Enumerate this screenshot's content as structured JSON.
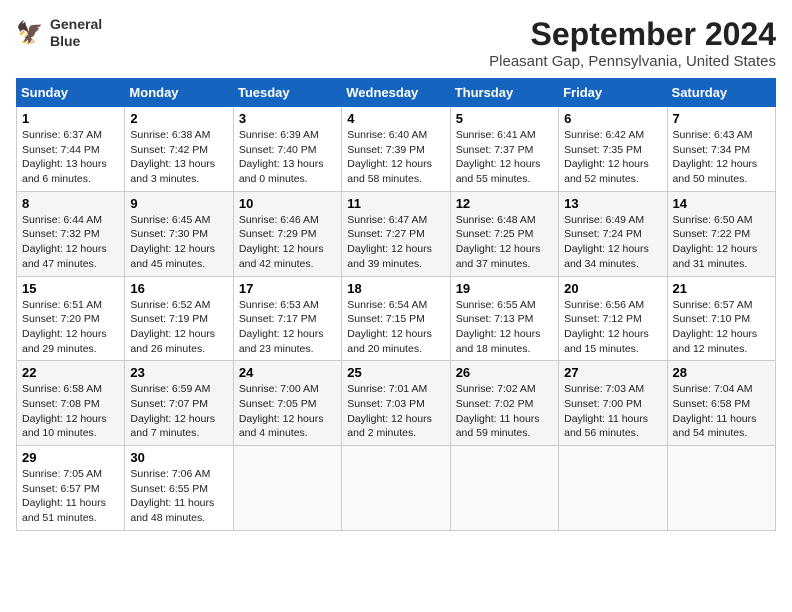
{
  "header": {
    "logo_line1": "General",
    "logo_line2": "Blue",
    "month": "September 2024",
    "location": "Pleasant Gap, Pennsylvania, United States"
  },
  "days_of_week": [
    "Sunday",
    "Monday",
    "Tuesday",
    "Wednesday",
    "Thursday",
    "Friday",
    "Saturday"
  ],
  "weeks": [
    [
      {
        "day": "1",
        "sunrise": "6:37 AM",
        "sunset": "7:44 PM",
        "daylight": "13 hours and 6 minutes."
      },
      {
        "day": "2",
        "sunrise": "6:38 AM",
        "sunset": "7:42 PM",
        "daylight": "13 hours and 3 minutes."
      },
      {
        "day": "3",
        "sunrise": "6:39 AM",
        "sunset": "7:40 PM",
        "daylight": "13 hours and 0 minutes."
      },
      {
        "day": "4",
        "sunrise": "6:40 AM",
        "sunset": "7:39 PM",
        "daylight": "12 hours and 58 minutes."
      },
      {
        "day": "5",
        "sunrise": "6:41 AM",
        "sunset": "7:37 PM",
        "daylight": "12 hours and 55 minutes."
      },
      {
        "day": "6",
        "sunrise": "6:42 AM",
        "sunset": "7:35 PM",
        "daylight": "12 hours and 52 minutes."
      },
      {
        "day": "7",
        "sunrise": "6:43 AM",
        "sunset": "7:34 PM",
        "daylight": "12 hours and 50 minutes."
      }
    ],
    [
      {
        "day": "8",
        "sunrise": "6:44 AM",
        "sunset": "7:32 PM",
        "daylight": "12 hours and 47 minutes."
      },
      {
        "day": "9",
        "sunrise": "6:45 AM",
        "sunset": "7:30 PM",
        "daylight": "12 hours and 45 minutes."
      },
      {
        "day": "10",
        "sunrise": "6:46 AM",
        "sunset": "7:29 PM",
        "daylight": "12 hours and 42 minutes."
      },
      {
        "day": "11",
        "sunrise": "6:47 AM",
        "sunset": "7:27 PM",
        "daylight": "12 hours and 39 minutes."
      },
      {
        "day": "12",
        "sunrise": "6:48 AM",
        "sunset": "7:25 PM",
        "daylight": "12 hours and 37 minutes."
      },
      {
        "day": "13",
        "sunrise": "6:49 AM",
        "sunset": "7:24 PM",
        "daylight": "12 hours and 34 minutes."
      },
      {
        "day": "14",
        "sunrise": "6:50 AM",
        "sunset": "7:22 PM",
        "daylight": "12 hours and 31 minutes."
      }
    ],
    [
      {
        "day": "15",
        "sunrise": "6:51 AM",
        "sunset": "7:20 PM",
        "daylight": "12 hours and 29 minutes."
      },
      {
        "day": "16",
        "sunrise": "6:52 AM",
        "sunset": "7:19 PM",
        "daylight": "12 hours and 26 minutes."
      },
      {
        "day": "17",
        "sunrise": "6:53 AM",
        "sunset": "7:17 PM",
        "daylight": "12 hours and 23 minutes."
      },
      {
        "day": "18",
        "sunrise": "6:54 AM",
        "sunset": "7:15 PM",
        "daylight": "12 hours and 20 minutes."
      },
      {
        "day": "19",
        "sunrise": "6:55 AM",
        "sunset": "7:13 PM",
        "daylight": "12 hours and 18 minutes."
      },
      {
        "day": "20",
        "sunrise": "6:56 AM",
        "sunset": "7:12 PM",
        "daylight": "12 hours and 15 minutes."
      },
      {
        "day": "21",
        "sunrise": "6:57 AM",
        "sunset": "7:10 PM",
        "daylight": "12 hours and 12 minutes."
      }
    ],
    [
      {
        "day": "22",
        "sunrise": "6:58 AM",
        "sunset": "7:08 PM",
        "daylight": "12 hours and 10 minutes."
      },
      {
        "day": "23",
        "sunrise": "6:59 AM",
        "sunset": "7:07 PM",
        "daylight": "12 hours and 7 minutes."
      },
      {
        "day": "24",
        "sunrise": "7:00 AM",
        "sunset": "7:05 PM",
        "daylight": "12 hours and 4 minutes."
      },
      {
        "day": "25",
        "sunrise": "7:01 AM",
        "sunset": "7:03 PM",
        "daylight": "12 hours and 2 minutes."
      },
      {
        "day": "26",
        "sunrise": "7:02 AM",
        "sunset": "7:02 PM",
        "daylight": "11 hours and 59 minutes."
      },
      {
        "day": "27",
        "sunrise": "7:03 AM",
        "sunset": "7:00 PM",
        "daylight": "11 hours and 56 minutes."
      },
      {
        "day": "28",
        "sunrise": "7:04 AM",
        "sunset": "6:58 PM",
        "daylight": "11 hours and 54 minutes."
      }
    ],
    [
      {
        "day": "29",
        "sunrise": "7:05 AM",
        "sunset": "6:57 PM",
        "daylight": "11 hours and 51 minutes."
      },
      {
        "day": "30",
        "sunrise": "7:06 AM",
        "sunset": "6:55 PM",
        "daylight": "11 hours and 48 minutes."
      },
      null,
      null,
      null,
      null,
      null
    ]
  ]
}
